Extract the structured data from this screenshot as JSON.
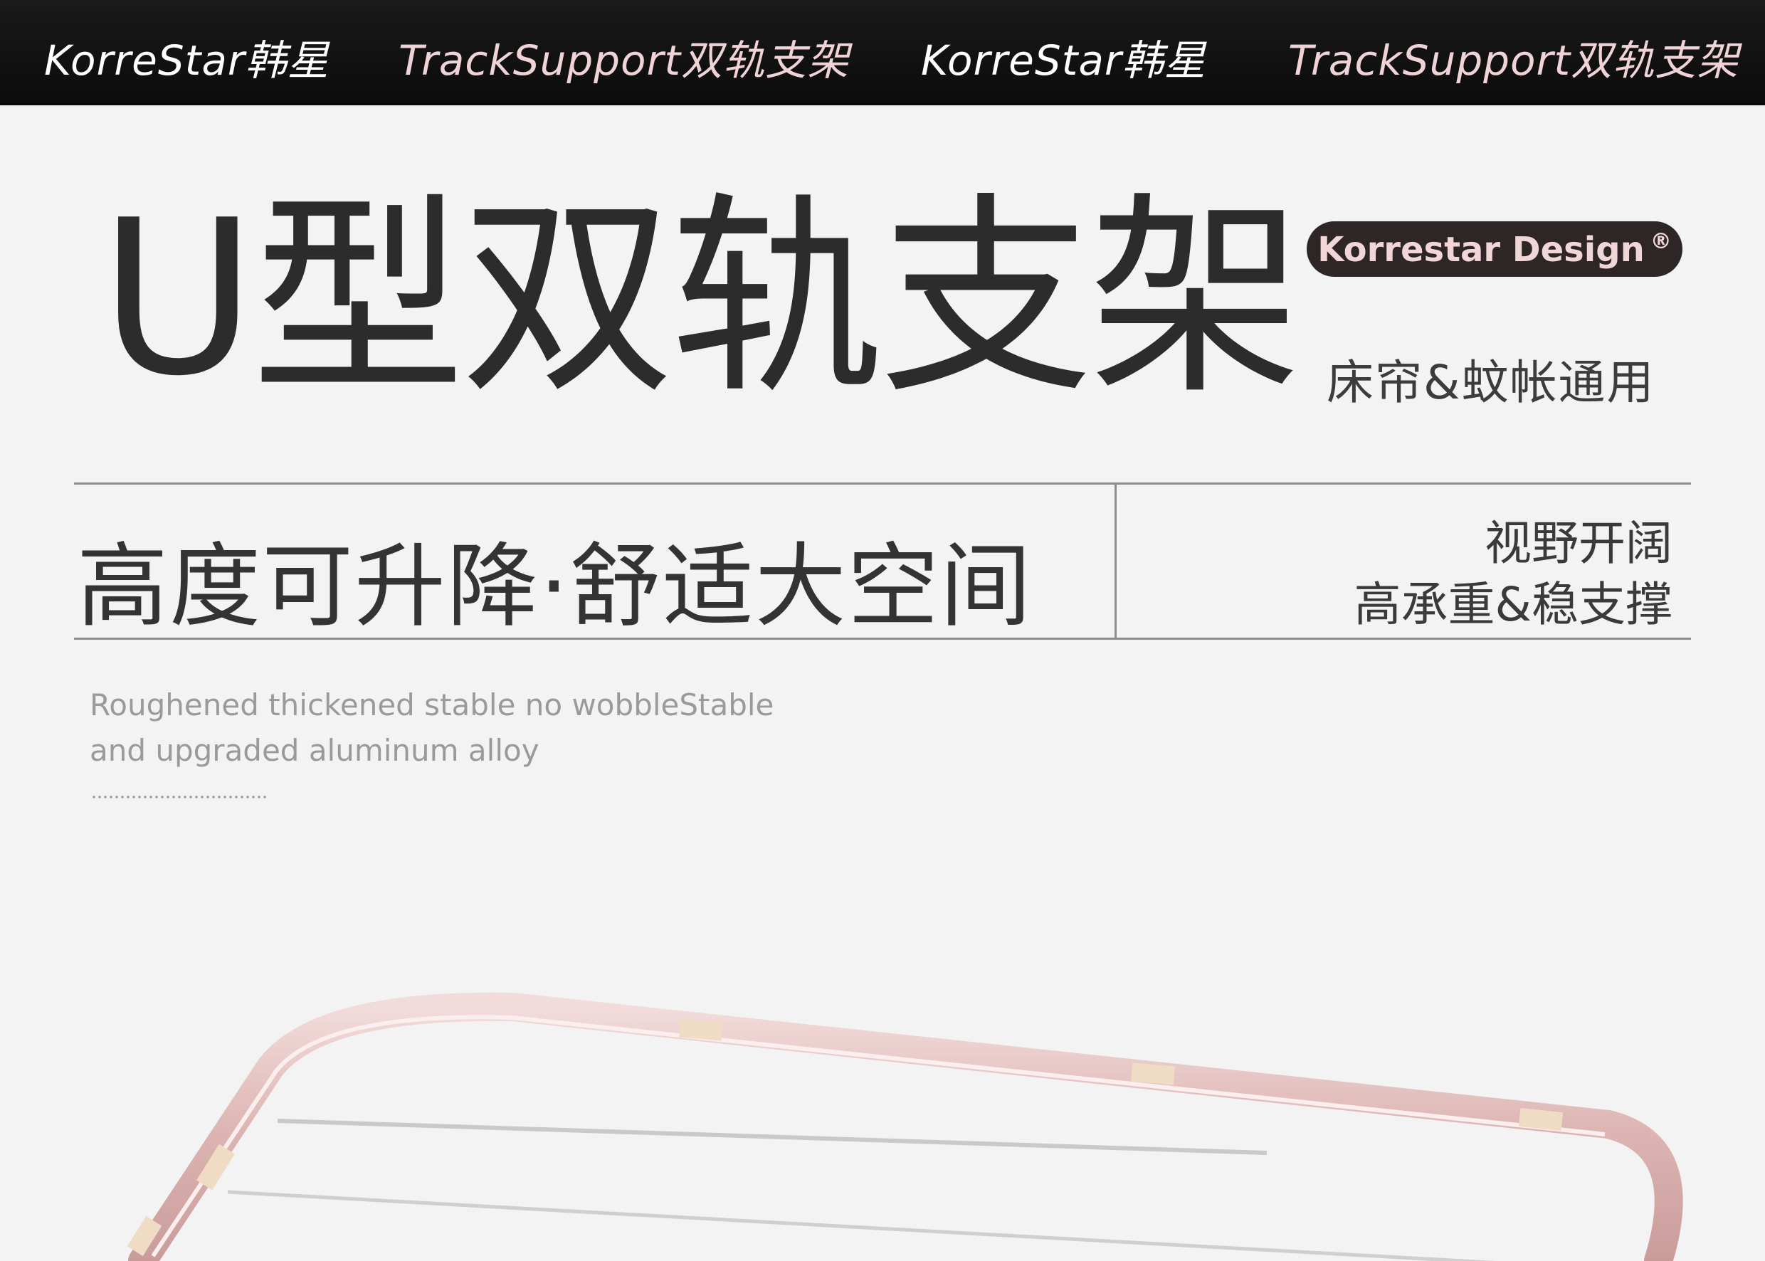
{
  "banner": {
    "items": [
      "KorreStar韩星",
      "TrackSupport双轨支架",
      "KorreStar韩星",
      "TrackSupport双轨支架"
    ]
  },
  "title": "U型双轨支架",
  "badge": {
    "text": "Korrestar Design",
    "mark": "®"
  },
  "subtitle": "床帘&蚊帐通用",
  "slogan": "高度可升降·舒适大空间",
  "features": [
    "视野开阔",
    "高承重&稳支撑"
  ],
  "english": [
    "Roughened thickened stable no wobbleStable",
    "and upgraded aluminum alloy"
  ],
  "colors": {
    "banner_bg": "#0b0b0b",
    "accent_pink": "#efd3d6",
    "rail": "#e5c5c3",
    "text_dark": "#2c2c2c"
  }
}
